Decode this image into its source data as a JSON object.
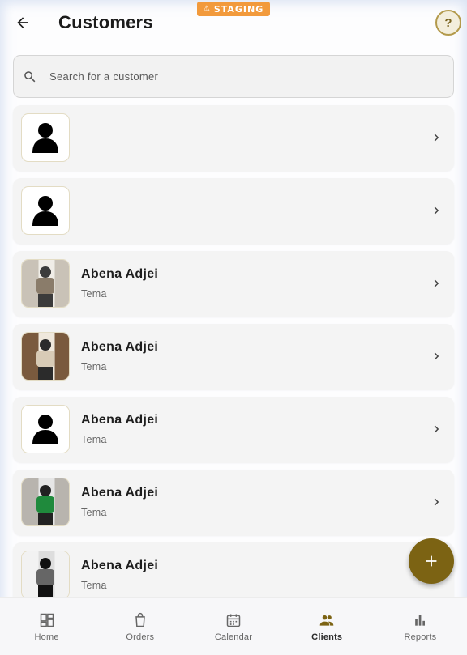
{
  "staging": {
    "label": "STAGING"
  },
  "header": {
    "title": "Customers",
    "help_label": "?"
  },
  "search": {
    "placeholder": "Search for a customer",
    "value": ""
  },
  "customers": [
    {
      "name": "",
      "location": "",
      "avatar": "default-avatar-icon"
    },
    {
      "name": "",
      "location": "",
      "avatar": "default-avatar-icon"
    },
    {
      "name": "Abena Adjei",
      "location": "Tema",
      "avatar": "photo"
    },
    {
      "name": "Abena Adjei",
      "location": "Tema",
      "avatar": "photo"
    },
    {
      "name": "Abena Adjei",
      "location": "Tema",
      "avatar": "default-avatar-icon"
    },
    {
      "name": "Abena Adjei",
      "location": "Tema",
      "avatar": "photo"
    },
    {
      "name": "Abena Adjei",
      "location": "Tema",
      "avatar": "photo"
    }
  ],
  "fab": {
    "icon": "plus-icon"
  },
  "nav": [
    {
      "label": "Home",
      "icon": "dashboard-icon",
      "active": false
    },
    {
      "label": "Orders",
      "icon": "shopping-bag-icon",
      "active": false
    },
    {
      "label": "Calendar",
      "icon": "calendar-icon",
      "active": false
    },
    {
      "label": "Clients",
      "icon": "people-icon",
      "active": true
    },
    {
      "label": "Reports",
      "icon": "bar-chart-icon",
      "active": false
    }
  ],
  "colors": {
    "accent": "#7c6313",
    "active_icon": "#7c6313",
    "staging": "#f29a3c"
  }
}
